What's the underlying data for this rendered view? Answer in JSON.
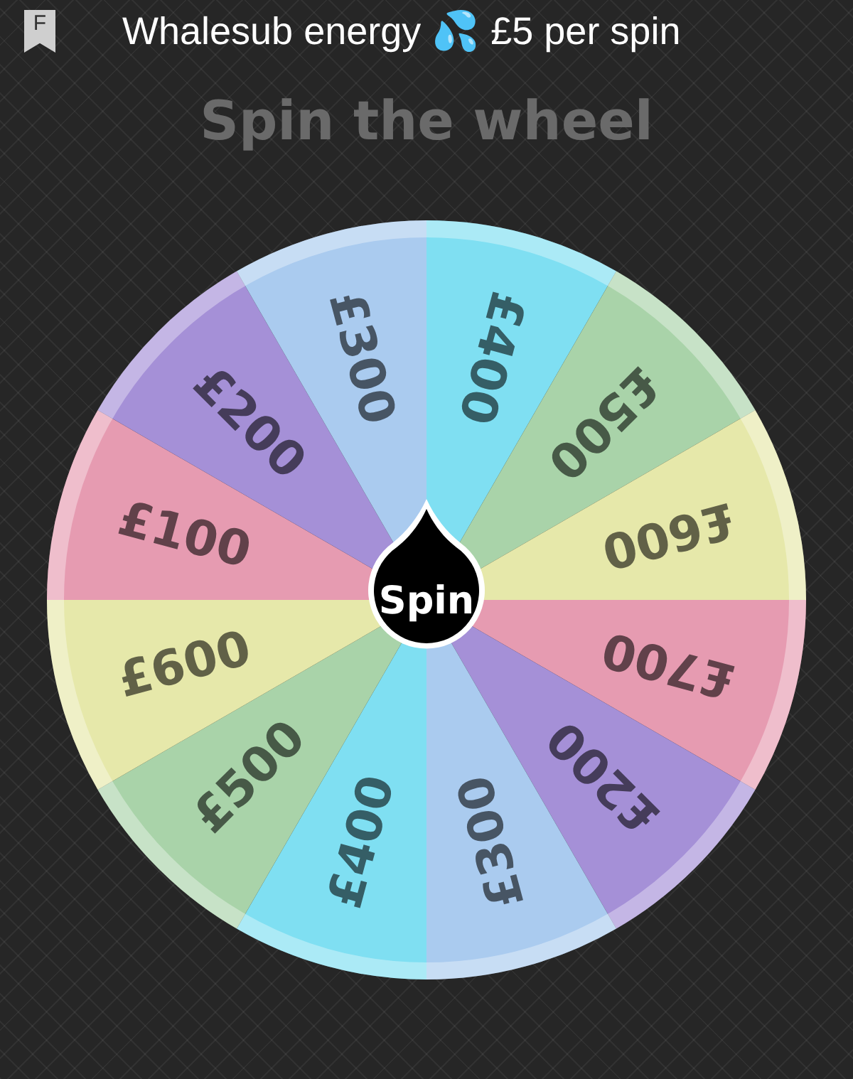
{
  "header": {
    "bookmark_letter": "F",
    "title": "Whalesub energy 💦 £5 per spin"
  },
  "heading": "Spin the wheel",
  "wheel": {
    "segments": [
      {
        "label": "£400",
        "color": "#7fdff2"
      },
      {
        "label": "£500",
        "color": "#a9d3a9"
      },
      {
        "label": "£600",
        "color": "#e6e8aa"
      },
      {
        "label": "£700",
        "color": "#e69bb1"
      },
      {
        "label": "£200",
        "color": "#a590d7"
      },
      {
        "label": "£300",
        "color": "#aacbef"
      },
      {
        "label": "£400",
        "color": "#7fdff2"
      },
      {
        "label": "£500",
        "color": "#a9d3a9"
      },
      {
        "label": "£600",
        "color": "#e6e8aa"
      },
      {
        "label": "£100",
        "color": "#e69bb1"
      },
      {
        "label": "£200",
        "color": "#a590d7"
      },
      {
        "label": "£300",
        "color": "#aacbef"
      }
    ],
    "button": "Spin"
  }
}
